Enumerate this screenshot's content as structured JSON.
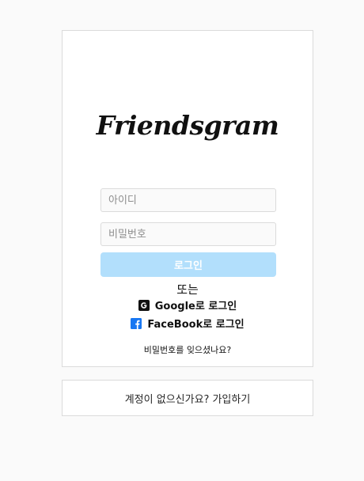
{
  "logo": {
    "text": "Friendsgram"
  },
  "login": {
    "id_placeholder": "아이디",
    "id_value": "",
    "password_placeholder": "비밀번호",
    "password_value": "",
    "button_label": "로그인",
    "or_text": "또는",
    "google_label": "Google로 로그인",
    "facebook_label": "FaceBook로 로그인",
    "forgot_password": "비밀번호를 잊으셨나요?"
  },
  "signup": {
    "prompt": "계정이 없으신가요?",
    "link": "가입하기"
  },
  "colors": {
    "background": "#fafafa",
    "card": "#ffffff",
    "border": "#dbdbdb",
    "button_disabled": "#b2dffc",
    "facebook_blue": "#1877f2"
  },
  "icons": {
    "google": "google-icon",
    "facebook": "facebook-icon"
  }
}
